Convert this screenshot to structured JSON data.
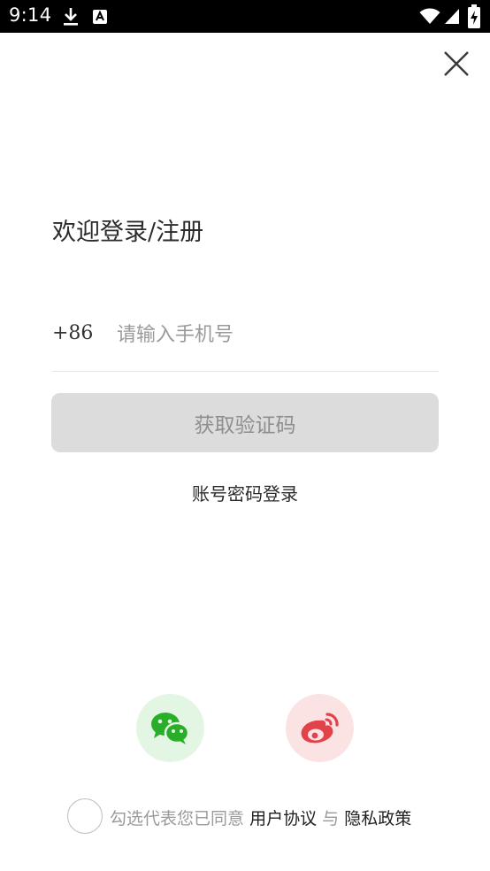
{
  "status_bar": {
    "time": "9:14",
    "icons": [
      "download-icon",
      "font-a-icon",
      "wifi-icon",
      "signal-icon",
      "battery-charging-icon"
    ]
  },
  "close_icon": "close-icon",
  "welcome_title": "欢迎登录/注册",
  "phone": {
    "country_code": "+86",
    "placeholder": "请输入手机号",
    "value": ""
  },
  "get_code_label": "获取验证码",
  "password_login_label": "账号密码登录",
  "social": [
    {
      "name": "wechat",
      "icon": "wechat-icon",
      "color": "#2aae2a",
      "bg": "#e3f6e3"
    },
    {
      "name": "weibo",
      "icon": "weibo-icon",
      "color": "#e2424a",
      "bg": "#fbe3e3"
    }
  ],
  "agreement": {
    "prefix": "勾选代表您已同意",
    "user_agreement": "用户协议",
    "conjunction": "与",
    "privacy_policy": "隐私政策",
    "checked": false
  },
  "colors": {
    "button_disabled_bg": "#dcdcdc",
    "button_disabled_text": "#8e8e8e",
    "placeholder": "#9a9a9a"
  }
}
